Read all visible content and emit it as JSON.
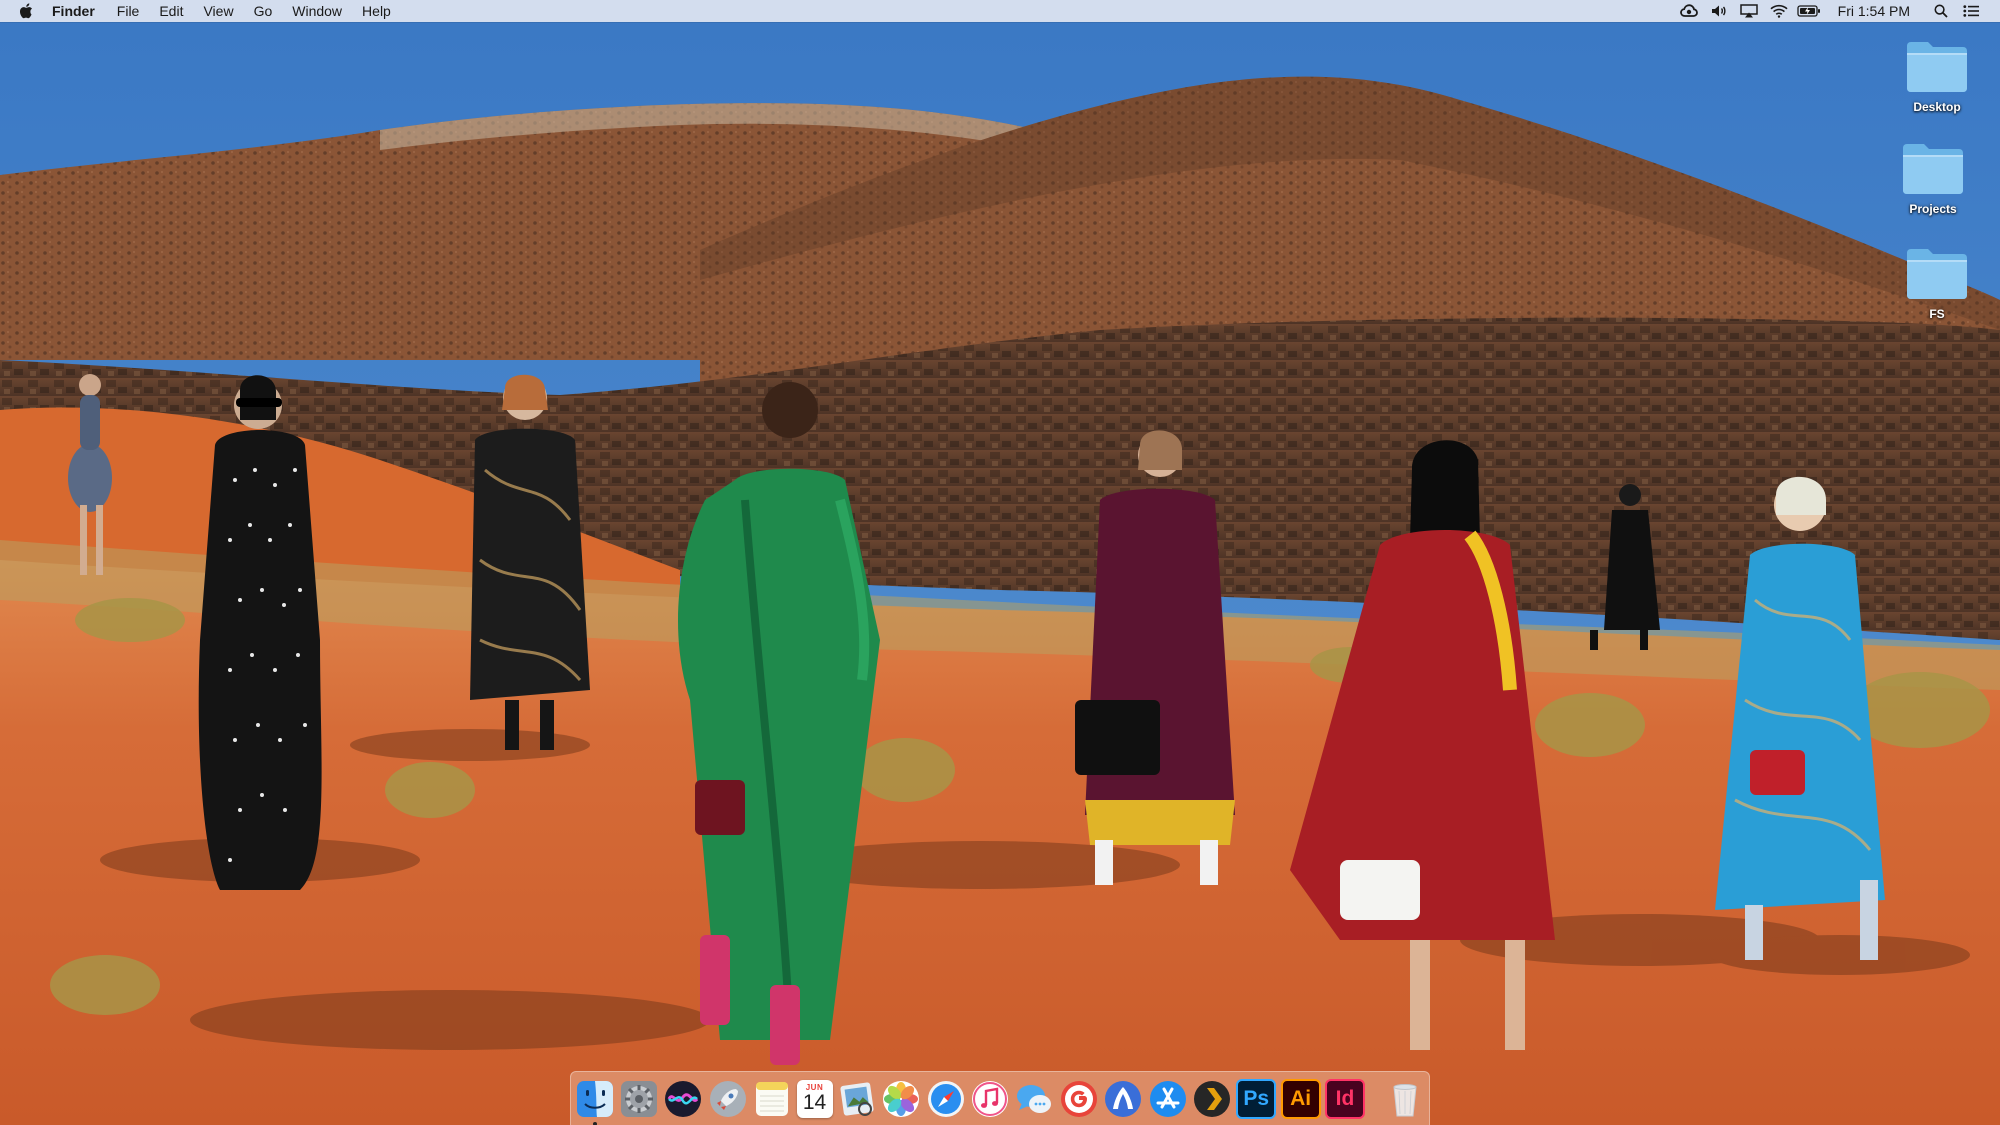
{
  "menubar": {
    "apple_icon": "apple-logo",
    "app_name": "Finder",
    "menus": [
      "File",
      "Edit",
      "View",
      "Go",
      "Window",
      "Help"
    ],
    "status_icons": [
      "creative-cloud-icon",
      "volume-icon",
      "airplay-icon",
      "wifi-icon",
      "battery-icon"
    ],
    "clock": "Fri 1:54 PM",
    "spotlight_icon": "search-icon",
    "notification_icon": "notification-center-icon"
  },
  "desktop": {
    "folders": [
      {
        "label": "Desktop"
      },
      {
        "label": "Projects"
      },
      {
        "label": "FS"
      }
    ]
  },
  "dock": {
    "apps": [
      {
        "name": "Finder",
        "icon": "finder-icon",
        "running": true
      },
      {
        "name": "System Preferences",
        "icon": "gear-icon",
        "running": false
      },
      {
        "name": "Siri",
        "icon": "siri-icon",
        "running": false
      },
      {
        "name": "Launchpad",
        "icon": "rocket-icon",
        "running": false
      },
      {
        "name": "Notes",
        "icon": "notes-icon",
        "running": false
      },
      {
        "name": "Calendar",
        "icon": "calendar-icon",
        "month": "JUN",
        "day": "14",
        "running": false
      },
      {
        "name": "Preview",
        "icon": "preview-icon",
        "running": false
      },
      {
        "name": "Photos",
        "icon": "photos-icon",
        "running": false
      },
      {
        "name": "Safari",
        "icon": "compass-icon",
        "running": false
      },
      {
        "name": "iTunes",
        "icon": "music-note-icon",
        "running": false
      },
      {
        "name": "Messages",
        "icon": "chat-bubble-icon",
        "running": false
      },
      {
        "name": "Google Chrome",
        "icon": "google-icon",
        "running": false
      },
      {
        "name": "Web Browser",
        "icon": "globe-icon",
        "running": false
      },
      {
        "name": "App Store",
        "icon": "app-store-icon",
        "running": false
      },
      {
        "name": "Plex",
        "icon": "chevron-right-icon",
        "running": false
      },
      {
        "name": "Photoshop",
        "icon": "photoshop-icon",
        "text": "Ps",
        "running": false
      },
      {
        "name": "Illustrator",
        "icon": "illustrator-icon",
        "text": "Ai",
        "running": false
      },
      {
        "name": "InDesign",
        "icon": "indesign-icon",
        "text": "Id",
        "running": false
      }
    ],
    "trash": {
      "name": "Trash",
      "icon": "trash-icon"
    }
  },
  "colors": {
    "sky": "#3f7fc6",
    "sand": "#d4693a",
    "rock": "#8a5a3c",
    "photoshop": "#31a8ff",
    "illustrator": "#ff9a00",
    "indesign": "#ff3366"
  }
}
